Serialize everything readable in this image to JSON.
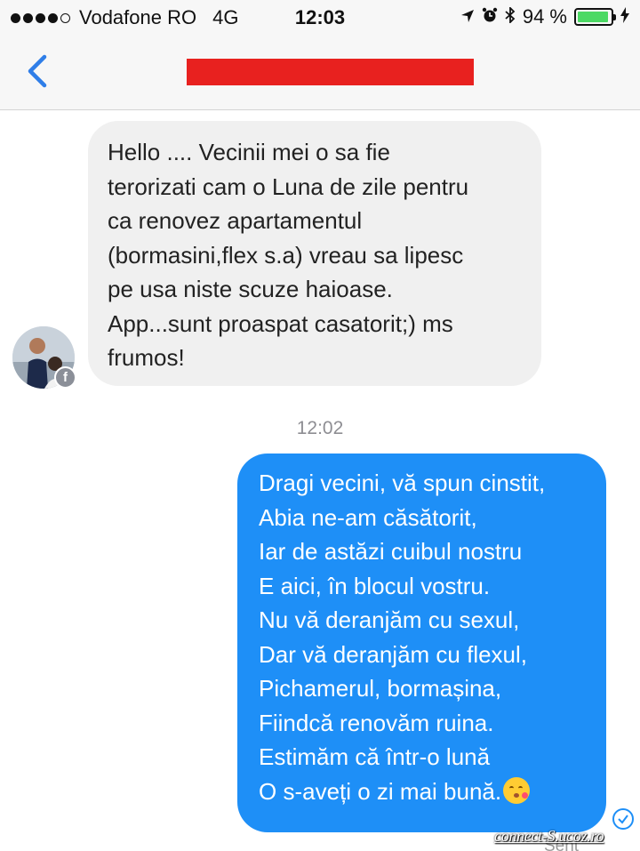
{
  "status_bar": {
    "carrier": "Vodafone RO",
    "network": "4G",
    "time": "12:03",
    "battery_percent": "94 %",
    "battery_level": 0.94
  },
  "nav": {
    "back_icon": "chevron-left-icon",
    "title_redacted": true,
    "redaction_color": "#e8211f",
    "accent_color": "#1e8ff7"
  },
  "incoming_message": {
    "lines": [
      "Hello .... Vecinii mei o sa fie",
      "terorizati cam o Luna de zile pentru",
      "ca renovez apartamentul",
      "(bormasini,flex s.a) vreau sa lipesc",
      "pe usa niste scuze haioase.",
      "App...sunt proaspat casatorit;) ms",
      "frumos!"
    ],
    "bubble_color": "#f0f0f0"
  },
  "timestamp": "12:02",
  "outgoing_message": {
    "lines": [
      "Dragi vecini, vă spun cinstit,",
      "Abia ne-am căsătorit,",
      "Iar de astăzi cuibul nostru",
      "E aici, în blocul vostru.",
      "Nu vă deranjăm cu sexul,",
      "Dar vă deranjăm cu flexul,",
      "Pichamerul, bormașina,",
      "Fiindcă renovăm ruina.",
      "Estimăm că într-o lună",
      "O s-aveți o zi mai bună."
    ],
    "emoji": "kissing-face-emoji",
    "bubble_color": "#1e8ff7"
  },
  "delivery_status": "Sent",
  "watermark": "connect-S.ucoz.ro"
}
